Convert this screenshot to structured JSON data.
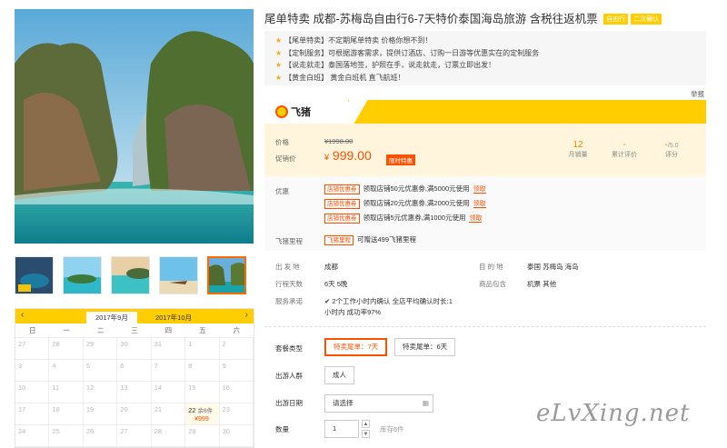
{
  "product": {
    "title": "尾单特卖 成都-苏梅岛自由行6-7天特价泰国海岛旅游 含税往返机票",
    "tags": [
      "自由行",
      "二次确认"
    ],
    "bullets": [
      "【尾单特卖】不定期尾单特卖 价格你想不到！",
      "【定制服务】可根据游客需求，提供订酒店、订购一日游等优惠实在的定制服务",
      "【说走就走】泰国落地签，护照在手，说走就走，订票立即出发！",
      "【黄金白班】 黄金白班机 直飞航班！"
    ],
    "report_label": "举报",
    "brand": "飞猪"
  },
  "price": {
    "price_label": "价格",
    "original": "¥1998.00",
    "promo_label": "促销价",
    "currency": "¥",
    "current": "999.00",
    "limited_tag": "限时特惠",
    "stats": [
      {
        "value": "12",
        "label": "月销量"
      },
      {
        "value": "-",
        "label": "累计评价"
      },
      {
        "value": "-",
        "suffix": "/5.0",
        "label": "评分"
      }
    ]
  },
  "promotions": {
    "label": "优惠",
    "coupons": [
      {
        "chip": "店铺优惠券",
        "text": "领取店铺50元优惠券,满5000元使用",
        "action": "领取"
      },
      {
        "chip": "店铺优惠券",
        "text": "领取店铺20元优惠券,满2000元使用",
        "action": "领取"
      },
      {
        "chip": "店铺优惠券",
        "text": "领取店铺5元优惠券,满1000元使用",
        "action": "领取"
      }
    ],
    "mileage_label": "飞猪里程",
    "mileage_chip": "飞猪里程",
    "mileage_text": "可赠送499飞猪里程"
  },
  "details": {
    "from_label": "出 发 地",
    "from": "成都",
    "dest_label": "目 的 地",
    "dest": "泰国  苏梅岛  海岛",
    "days_label": "行程天数",
    "days": "6天  5晚",
    "includes_label": "商品包含",
    "includes": "机票  其他",
    "service_label": "服务承诺",
    "service_line1": "2个工作小时内确认  全店平均确认时长:1",
    "service_line2": "小时内  成功率97%"
  },
  "booking": {
    "package_label": "套餐类型",
    "packages": [
      "特卖尾单：7天",
      "特卖尾单：6天"
    ],
    "crowd_label": "出游人群",
    "crowd": "成人",
    "date_label": "出游日期",
    "date_placeholder": "请选择",
    "qty_label": "数量",
    "qty": "1",
    "stock": "库存6件"
  },
  "calendar": {
    "months": [
      "2017年9月",
      "2017年10月"
    ],
    "weekdays": [
      "日",
      "一",
      "二",
      "三",
      "四",
      "五",
      "六"
    ],
    "rows": [
      [
        "27",
        "28",
        "29",
        "30",
        "31",
        "1",
        "2"
      ],
      [
        "3",
        "4",
        "5",
        "6",
        "7",
        "8",
        "9"
      ],
      [
        "10",
        "11",
        "12",
        "13",
        "14",
        "15",
        "16"
      ],
      [
        "17",
        "18",
        "19",
        "20",
        "21",
        "22",
        "23"
      ],
      [
        "24",
        "25",
        "26",
        "27",
        "28",
        "29",
        "30"
      ]
    ],
    "special": {
      "day": "22",
      "rest": "余6件",
      "price": "¥999"
    }
  },
  "watermark": "eLvXing.net",
  "colors": {
    "accent": "#ff5000",
    "brand_yellow": "#ffcd00"
  }
}
